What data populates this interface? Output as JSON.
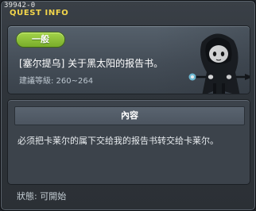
{
  "window": {
    "quest_id": "39942-0",
    "title": "QUEST INFO"
  },
  "header": {
    "badge_label": "一般",
    "quest_name": "[塞尔提乌] 关于黑太阳的报告书。",
    "level_text": "建議等級: 260~264",
    "npc_icon": "hooded-npc-icon"
  },
  "content": {
    "title": "內容",
    "text": "必须把卡莱尔的属下交给我的报告书转交给卡莱尔。"
  },
  "footer": {
    "status_text": "狀態: 可開始"
  },
  "colors": {
    "title_accent": "#f3d64b",
    "badge_green": "#8cc23a",
    "panel_bg": "#3c434b"
  }
}
